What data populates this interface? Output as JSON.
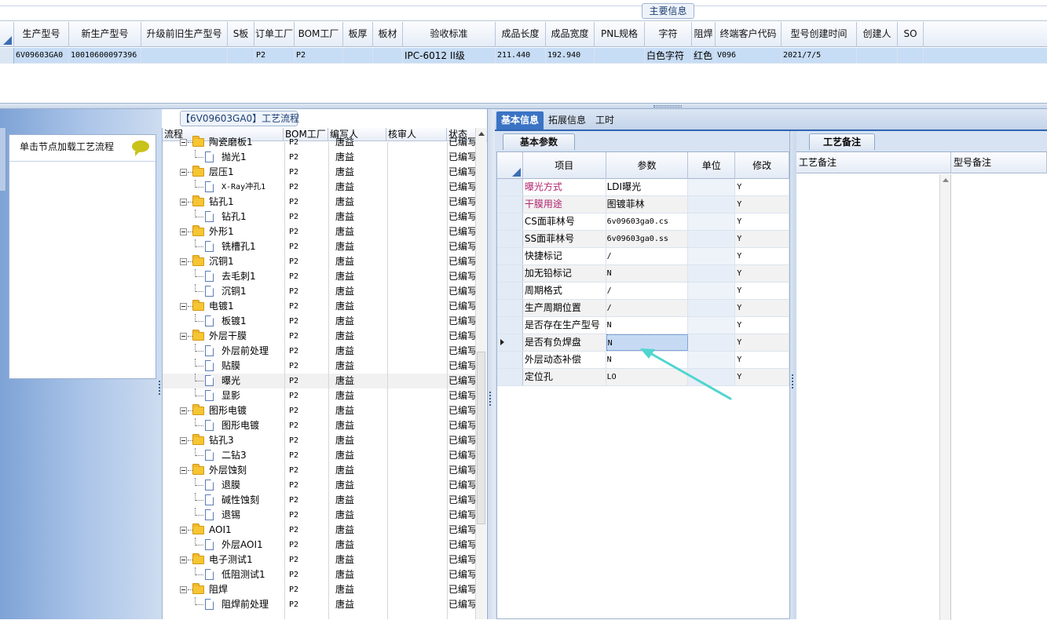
{
  "top": {
    "main_info_tab": "主要信息",
    "headers": [
      "生产型号",
      "新生产型号",
      "升级前旧生产型号",
      "S板",
      "订单工厂",
      "BOM工厂",
      "板厚",
      "板材",
      "验收标准",
      "成品长度",
      "成品宽度",
      "PNL规格",
      "字符",
      "阻焊",
      "终端客户代码",
      "型号创建时间",
      "创建人",
      "SO"
    ],
    "row": [
      "6V09603GA0",
      "10010600097396",
      "",
      "",
      "P2",
      "P2",
      "",
      "",
      "IPC-6012 II级",
      "211.440",
      "192.940",
      "",
      "白色字符",
      "红色",
      "V096",
      "2021/7/5",
      "",
      ""
    ]
  },
  "left": {
    "panel_title": "单击节点加载工艺流程"
  },
  "tree": {
    "title": "【6V09603GA0】工艺流程",
    "headers": [
      "流程",
      "BOM工厂",
      "编写人",
      "核审人",
      "状态"
    ],
    "rows": [
      {
        "name": "陶瓷磨板1",
        "level": 0,
        "bom": "P2",
        "writer": "唐益",
        "reviewer": "",
        "status": "已编写"
      },
      {
        "name": "抛光1",
        "level": 1,
        "bom": "P2",
        "writer": "唐益",
        "reviewer": "",
        "status": "已编写"
      },
      {
        "name": "层压1",
        "level": 0,
        "bom": "P2",
        "writer": "唐益",
        "reviewer": "",
        "status": "已编写"
      },
      {
        "name": "X-Ray冲孔1",
        "level": 1,
        "bom": "P2",
        "writer": "唐益",
        "reviewer": "",
        "status": "已编写"
      },
      {
        "name": "钻孔1",
        "level": 0,
        "bom": "P2",
        "writer": "唐益",
        "reviewer": "",
        "status": "已编写"
      },
      {
        "name": "钻孔1",
        "level": 1,
        "bom": "P2",
        "writer": "唐益",
        "reviewer": "",
        "status": "已编写"
      },
      {
        "name": "外形1",
        "level": 0,
        "bom": "P2",
        "writer": "唐益",
        "reviewer": "",
        "status": "已编写"
      },
      {
        "name": "铣槽孔1",
        "level": 1,
        "bom": "P2",
        "writer": "唐益",
        "reviewer": "",
        "status": "已编写"
      },
      {
        "name": "沉铜1",
        "level": 0,
        "bom": "P2",
        "writer": "唐益",
        "reviewer": "",
        "status": "已编写"
      },
      {
        "name": "去毛刺1",
        "level": 1,
        "bom": "P2",
        "writer": "唐益",
        "reviewer": "",
        "status": "已编写"
      },
      {
        "name": "沉铜1",
        "level": 1,
        "bom": "P2",
        "writer": "唐益",
        "reviewer": "",
        "status": "已编写"
      },
      {
        "name": "电镀1",
        "level": 0,
        "bom": "P2",
        "writer": "唐益",
        "reviewer": "",
        "status": "已编写"
      },
      {
        "name": "板镀1",
        "level": 1,
        "bom": "P2",
        "writer": "唐益",
        "reviewer": "",
        "status": "已编写"
      },
      {
        "name": "外层干膜",
        "level": 0,
        "bom": "P2",
        "writer": "唐益",
        "reviewer": "",
        "status": "已编写"
      },
      {
        "name": "外层前处理",
        "level": 1,
        "bom": "P2",
        "writer": "唐益",
        "reviewer": "",
        "status": "已编写"
      },
      {
        "name": "贴膜",
        "level": 1,
        "bom": "P2",
        "writer": "唐益",
        "reviewer": "",
        "status": "已编写"
      },
      {
        "name": "曝光",
        "level": 1,
        "bom": "P2",
        "writer": "唐益",
        "reviewer": "",
        "status": "已编写",
        "selected": true
      },
      {
        "name": "显影",
        "level": 1,
        "bom": "P2",
        "writer": "唐益",
        "reviewer": "",
        "status": "已编写"
      },
      {
        "name": "图形电镀",
        "level": 0,
        "bom": "P2",
        "writer": "唐益",
        "reviewer": "",
        "status": "已编写"
      },
      {
        "name": "图形电镀",
        "level": 1,
        "bom": "P2",
        "writer": "唐益",
        "reviewer": "",
        "status": "已编写"
      },
      {
        "name": "钻孔3",
        "level": 0,
        "bom": "P2",
        "writer": "唐益",
        "reviewer": "",
        "status": "已编写"
      },
      {
        "name": "二钻3",
        "level": 1,
        "bom": "P2",
        "writer": "唐益",
        "reviewer": "",
        "status": "已编写"
      },
      {
        "name": "外层蚀刻",
        "level": 0,
        "bom": "P2",
        "writer": "唐益",
        "reviewer": "",
        "status": "已编写"
      },
      {
        "name": "退膜",
        "level": 1,
        "bom": "P2",
        "writer": "唐益",
        "reviewer": "",
        "status": "已编写"
      },
      {
        "name": "碱性蚀刻",
        "level": 1,
        "bom": "P2",
        "writer": "唐益",
        "reviewer": "",
        "status": "已编写"
      },
      {
        "name": "退锡",
        "level": 1,
        "bom": "P2",
        "writer": "唐益",
        "reviewer": "",
        "status": "已编写"
      },
      {
        "name": "AOI1",
        "level": 0,
        "bom": "P2",
        "writer": "唐益",
        "reviewer": "",
        "status": "已编写"
      },
      {
        "name": "外层AOI1",
        "level": 1,
        "bom": "P2",
        "writer": "唐益",
        "reviewer": "",
        "status": "已编写"
      },
      {
        "name": "电子测试1",
        "level": 0,
        "bom": "P2",
        "writer": "唐益",
        "reviewer": "",
        "status": "已编写"
      },
      {
        "name": "低阻测试1",
        "level": 1,
        "bom": "P2",
        "writer": "唐益",
        "reviewer": "",
        "status": "已编写"
      },
      {
        "name": "阻焊",
        "level": 0,
        "bom": "P2",
        "writer": "唐益",
        "reviewer": "",
        "status": "已编写"
      },
      {
        "name": "阻焊前处理",
        "level": 1,
        "bom": "P2",
        "writer": "唐益",
        "reviewer": "",
        "status": "已编写"
      }
    ]
  },
  "right": {
    "tabs": [
      "基本信息",
      "拓展信息",
      "工时"
    ],
    "sub_tab": "基本参数",
    "grid_headers": [
      "项目",
      "参数",
      "单位",
      "修改"
    ],
    "rows": [
      {
        "item": "曝光方式",
        "param": "LDI曝光",
        "unit": "",
        "mod": "Y",
        "highlight": true
      },
      {
        "item": "干膜用途",
        "param": "图镀菲林",
        "unit": "",
        "mod": "Y",
        "highlight": true
      },
      {
        "item": "CS面菲林号",
        "param": "6v09603ga0.cs",
        "unit": "",
        "mod": "Y"
      },
      {
        "item": "SS面菲林号",
        "param": "6v09603ga0.ss",
        "unit": "",
        "mod": "Y"
      },
      {
        "item": "快捷标记",
        "param": "/",
        "unit": "",
        "mod": "Y"
      },
      {
        "item": "加无铅标记",
        "param": "N",
        "unit": "",
        "mod": "Y"
      },
      {
        "item": "周期格式",
        "param": "/",
        "unit": "",
        "mod": "Y"
      },
      {
        "item": "生产周期位置",
        "param": "/",
        "unit": "",
        "mod": "Y"
      },
      {
        "item": "是否存在生产型号",
        "param": "N",
        "unit": "",
        "mod": "Y"
      },
      {
        "item": "是否有负焊盘",
        "param": "N",
        "unit": "",
        "mod": "Y",
        "current": true
      },
      {
        "item": "外层动态补偿",
        "param": "N",
        "unit": "",
        "mod": "Y"
      },
      {
        "item": "定位孔",
        "param": "LO",
        "unit": "",
        "mod": "Y"
      }
    ],
    "notes_tab": "工艺备注",
    "notes_headers": [
      "工艺备注",
      "型号备注"
    ]
  },
  "colors": {
    "accent": "#3b73c4",
    "selected_row": "#c7dcf5",
    "annotation_arrow": "#4fd6cf",
    "magenta_text": "#b1246f"
  }
}
